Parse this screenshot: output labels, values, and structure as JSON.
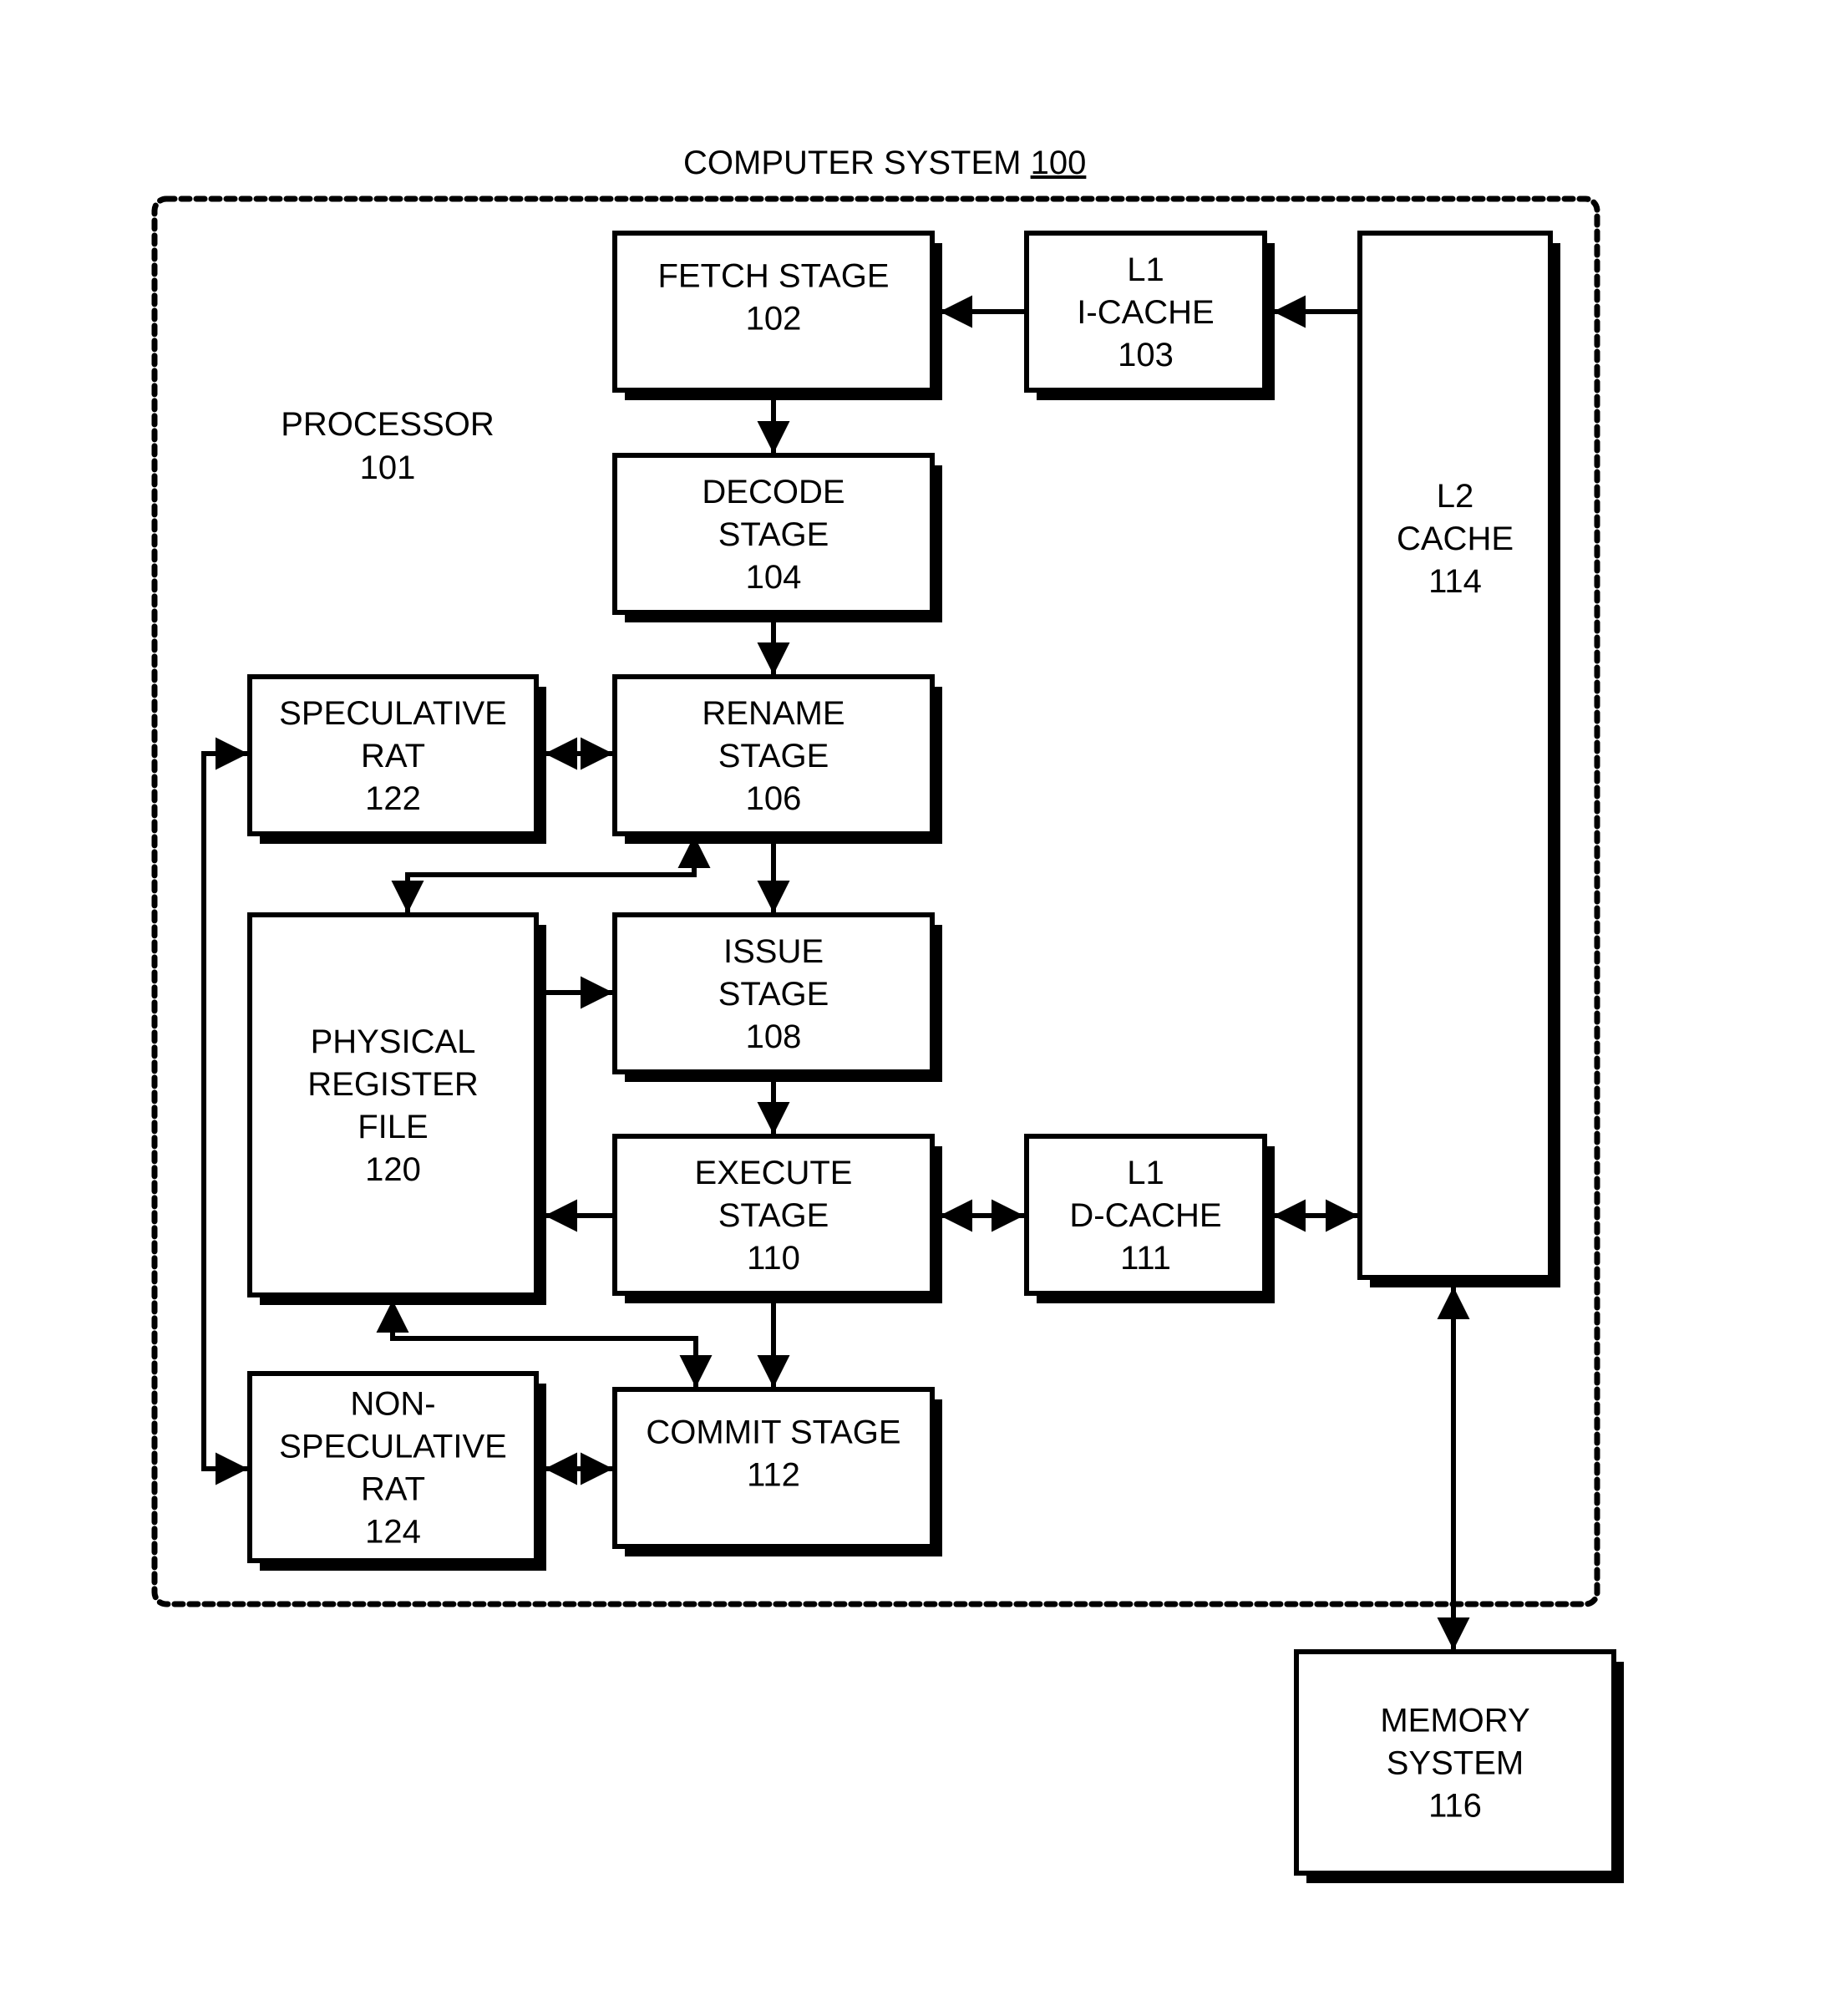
{
  "figure": {
    "title": "COMPUTER SYSTEM",
    "title_ref": "100",
    "container_label": "PROCESSOR",
    "container_ref": "101"
  },
  "blocks": {
    "fetch": {
      "lines": [
        "FETCH STAGE",
        "102"
      ]
    },
    "l1i": {
      "lines": [
        "L1",
        "I-CACHE",
        "103"
      ]
    },
    "decode": {
      "lines": [
        "DECODE",
        "STAGE",
        "104"
      ]
    },
    "rename": {
      "lines": [
        "RENAME",
        "STAGE",
        "106"
      ]
    },
    "spec_rat": {
      "lines": [
        "SPECULATIVE",
        "RAT",
        "122"
      ]
    },
    "prf": {
      "lines": [
        "PHYSICAL",
        "REGISTER",
        "FILE",
        "120"
      ]
    },
    "issue": {
      "lines": [
        "ISSUE",
        "STAGE",
        "108"
      ]
    },
    "execute": {
      "lines": [
        "EXECUTE",
        "STAGE",
        "110"
      ]
    },
    "l1d": {
      "lines": [
        "L1",
        "D-CACHE",
        "111"
      ]
    },
    "l2": {
      "lines": [
        "L2",
        "CACHE",
        "114"
      ]
    },
    "commit": {
      "lines": [
        "COMMIT STAGE",
        "112"
      ]
    },
    "nonspec_rat": {
      "lines": [
        "NON-",
        "SPECULATIVE",
        "RAT",
        "124"
      ]
    },
    "memory": {
      "lines": [
        "MEMORY",
        "SYSTEM",
        "116"
      ]
    }
  },
  "connections": [
    {
      "from": "l2",
      "to": "l1i",
      "direction": "one-way"
    },
    {
      "from": "l1i",
      "to": "fetch",
      "direction": "one-way"
    },
    {
      "from": "fetch",
      "to": "decode",
      "direction": "one-way"
    },
    {
      "from": "decode",
      "to": "rename",
      "direction": "one-way"
    },
    {
      "from": "spec_rat",
      "to": "rename",
      "direction": "bidirectional"
    },
    {
      "from": "rename",
      "to": "prf",
      "direction": "bidirectional"
    },
    {
      "from": "rename",
      "to": "issue",
      "direction": "one-way"
    },
    {
      "from": "prf",
      "to": "issue",
      "direction": "one-way"
    },
    {
      "from": "issue",
      "to": "execute",
      "direction": "one-way"
    },
    {
      "from": "execute",
      "to": "prf",
      "direction": "one-way"
    },
    {
      "from": "execute",
      "to": "l1d",
      "direction": "bidirectional"
    },
    {
      "from": "l1d",
      "to": "l2",
      "direction": "bidirectional"
    },
    {
      "from": "execute",
      "to": "commit",
      "direction": "one-way"
    },
    {
      "from": "prf",
      "to": "commit",
      "direction": "bidirectional"
    },
    {
      "from": "nonspec_rat",
      "to": "commit",
      "direction": "bidirectional"
    },
    {
      "from": "spec_rat",
      "to": "nonspec_rat",
      "direction": "bidirectional"
    },
    {
      "from": "l2",
      "to": "memory",
      "direction": "bidirectional"
    }
  ]
}
